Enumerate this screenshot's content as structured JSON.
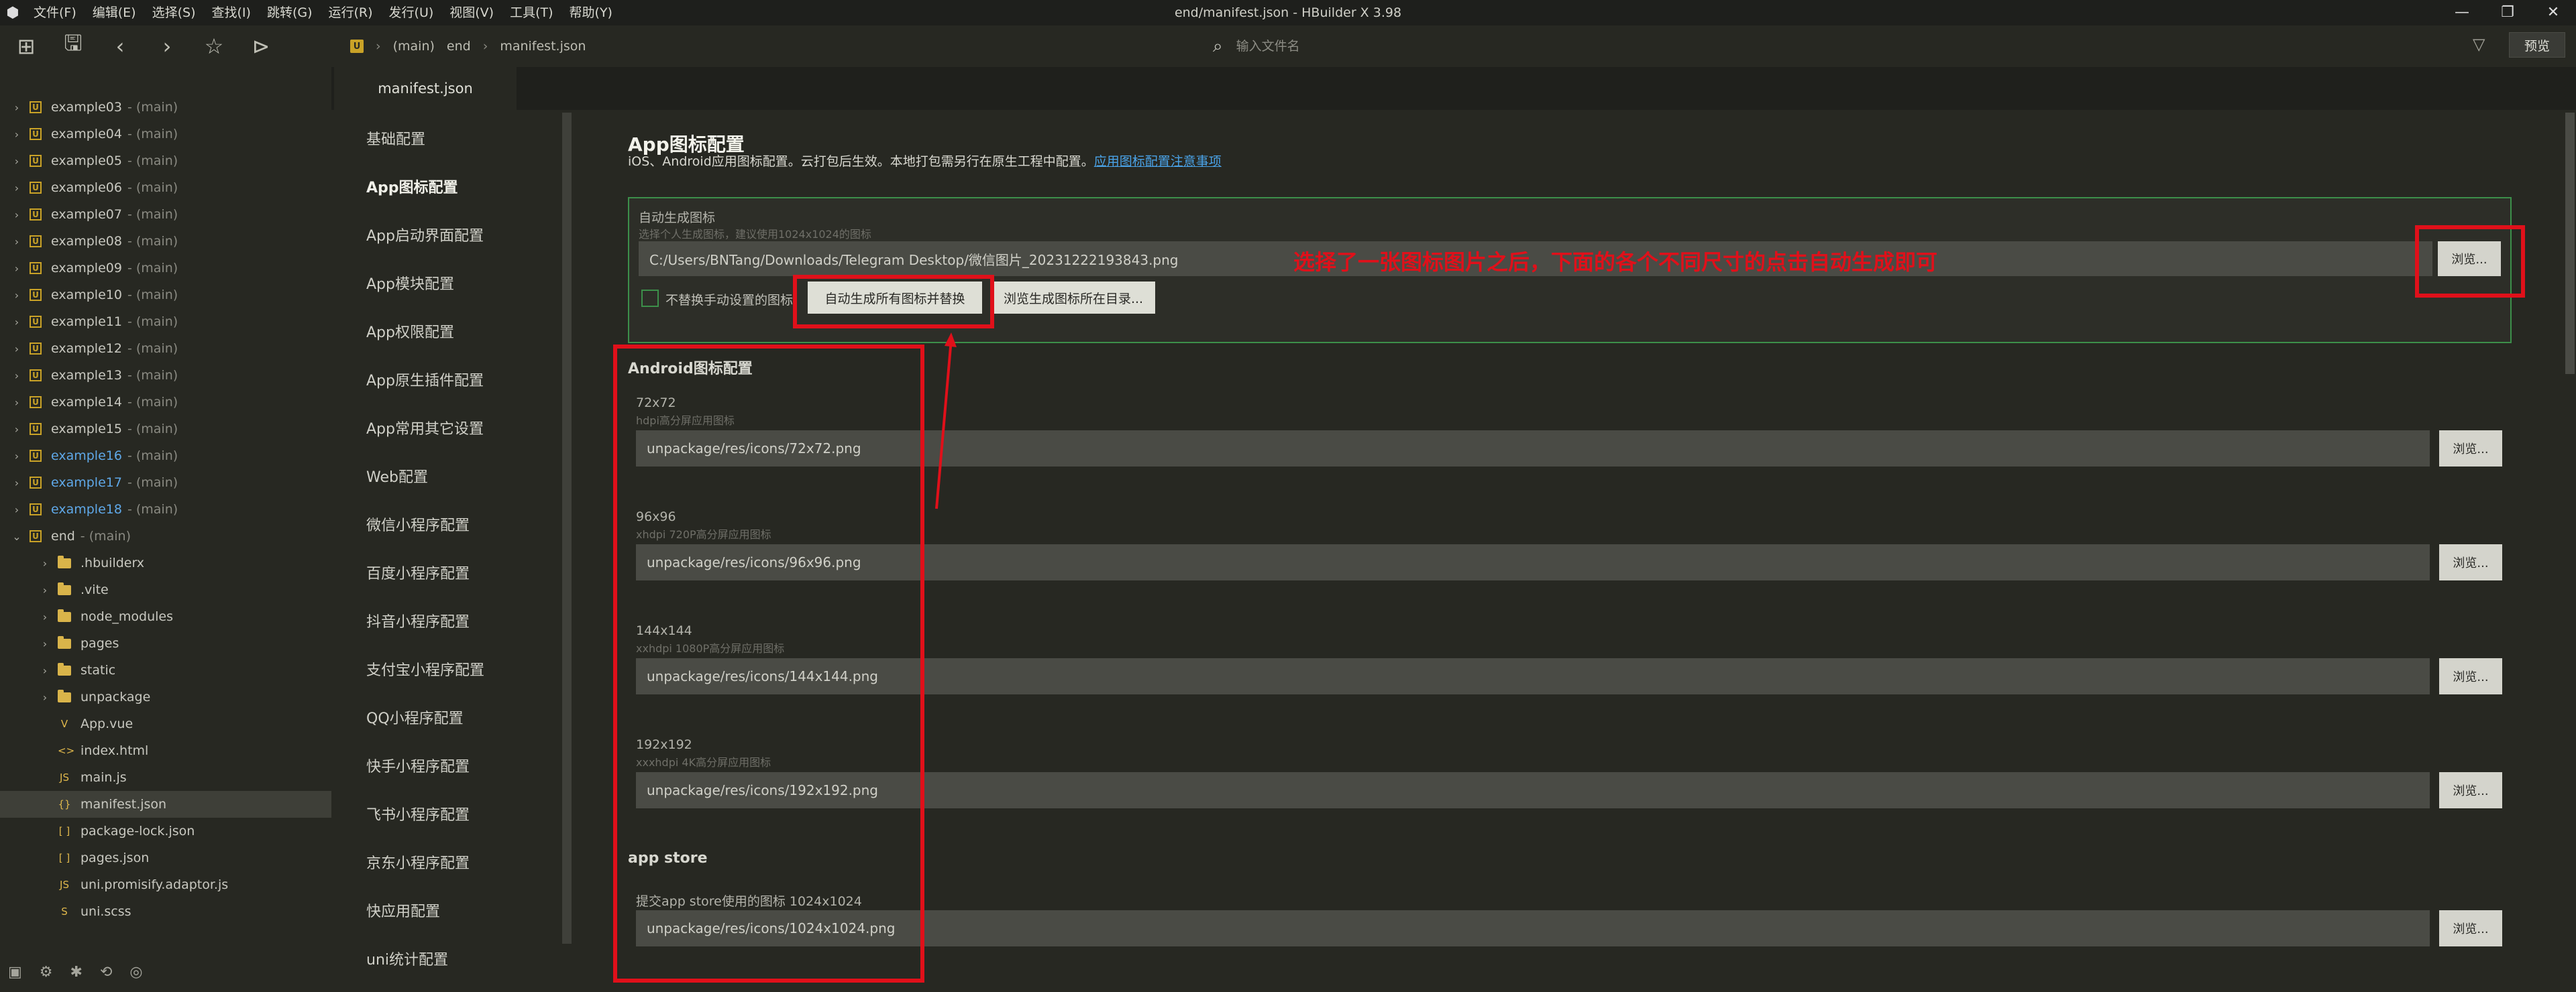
{
  "window": {
    "title": "end/manifest.json - HBuilder X 3.98",
    "controls": [
      "—",
      "❐",
      "✕"
    ]
  },
  "menu": [
    "文件(F)",
    "编辑(E)",
    "选择(S)",
    "查找(I)",
    "跳转(G)",
    "运行(R)",
    "发行(U)",
    "视图(V)",
    "工具(T)",
    "帮助(Y)"
  ],
  "toolbar": {
    "breadcrumb": {
      "badge": "U",
      "items": [
        "(main)",
        "end",
        "manifest.json"
      ]
    },
    "search_placeholder": "输入文件名",
    "preview_label": "预览"
  },
  "tree": {
    "projects": [
      {
        "name": "example03",
        "branch": "- (main)",
        "blue": false
      },
      {
        "name": "example04",
        "branch": "- (main)",
        "blue": false
      },
      {
        "name": "example05",
        "branch": "- (main)",
        "blue": false
      },
      {
        "name": "example06",
        "branch": "- (main)",
        "blue": false
      },
      {
        "name": "example07",
        "branch": "- (main)",
        "blue": false
      },
      {
        "name": "example08",
        "branch": "- (main)",
        "blue": false
      },
      {
        "name": "example09",
        "branch": "- (main)",
        "blue": false
      },
      {
        "name": "example10",
        "branch": "- (main)",
        "blue": false
      },
      {
        "name": "example11",
        "branch": "- (main)",
        "blue": false
      },
      {
        "name": "example12",
        "branch": "- (main)",
        "blue": false
      },
      {
        "name": "example13",
        "branch": "- (main)",
        "blue": false
      },
      {
        "name": "example14",
        "branch": "- (main)",
        "blue": false
      },
      {
        "name": "example15",
        "branch": "- (main)",
        "blue": false
      },
      {
        "name": "example16",
        "branch": "- (main)",
        "blue": true
      },
      {
        "name": "example17",
        "branch": "- (main)",
        "blue": true
      },
      {
        "name": "example18",
        "branch": "- (main)",
        "blue": true
      }
    ],
    "open_project": {
      "name": "end",
      "branch": "- (main)"
    },
    "folders": [
      ".hbuilderx",
      ".vite",
      "node_modules",
      "pages",
      "static",
      "unpackage"
    ],
    "files": [
      {
        "name": "App.vue",
        "icon": "V"
      },
      {
        "name": "index.html",
        "icon": "<>"
      },
      {
        "name": "main.js",
        "icon": "JS"
      },
      {
        "name": "manifest.json",
        "icon": "{}",
        "selected": true
      },
      {
        "name": "package-lock.json",
        "icon": "[ ]"
      },
      {
        "name": "pages.json",
        "icon": "[ ]"
      },
      {
        "name": "uni.promisify.adaptor.js",
        "icon": "JS"
      },
      {
        "name": "uni.scss",
        "icon": "S"
      }
    ]
  },
  "editor": {
    "tab_label": "manifest.json",
    "nav": [
      {
        "label": "基础配置",
        "active": false
      },
      {
        "label": "App图标配置",
        "active": true
      },
      {
        "label": "App启动界面配置",
        "active": false
      },
      {
        "label": "App模块配置",
        "active": false
      },
      {
        "label": "App权限配置",
        "active": false
      },
      {
        "label": "App原生插件配置",
        "active": false
      },
      {
        "label": "App常用其它设置",
        "active": false
      },
      {
        "label": "Web配置",
        "active": false
      },
      {
        "label": "微信小程序配置",
        "active": false
      },
      {
        "label": "百度小程序配置",
        "active": false
      },
      {
        "label": "抖音小程序配置",
        "active": false
      },
      {
        "label": "支付宝小程序配置",
        "active": false
      },
      {
        "label": "QQ小程序配置",
        "active": false
      },
      {
        "label": "快手小程序配置",
        "active": false
      },
      {
        "label": "飞书小程序配置",
        "active": false
      },
      {
        "label": "京东小程序配置",
        "active": false
      },
      {
        "label": "快应用配置",
        "active": false
      },
      {
        "label": "uni统计配置",
        "active": false
      }
    ],
    "page_title": "App图标配置",
    "page_desc": "iOS、Android应用图标配置。云打包后生效。本地打包需另行在原生工程中配置。",
    "page_link": "应用图标配置注意事项",
    "auto": {
      "label": "自动生成图标",
      "hint": "选择个人生成图标，建议使用1024x1024的图标",
      "path": "C:/Users/BNTang/Downloads/Telegram Desktop/微信图片_20231222193843.png",
      "browse": "浏览...",
      "checkbox_label": "不替换手动设置的图标",
      "generate_button": "自动生成所有图标并替换",
      "open_dir_button": "浏览生成图标所在目录..."
    },
    "android_title": "Android图标配置",
    "android_icons": [
      {
        "size": "72x72",
        "hint": "hdpi高分屏应用图标",
        "path": "unpackage/res/icons/72x72.png"
      },
      {
        "size": "96x96",
        "hint": "xhdpi 720P高分屏应用图标",
        "path": "unpackage/res/icons/96x96.png"
      },
      {
        "size": "144x144",
        "hint": "xxhdpi 1080P高分屏应用图标",
        "path": "unpackage/res/icons/144x144.png"
      },
      {
        "size": "192x192",
        "hint": "xxxhdpi 4K高分屏应用图标",
        "path": "unpackage/res/icons/192x192.png"
      }
    ],
    "appstore_title": "app store",
    "appstore": {
      "label": "提交app store使用的图标 1024x1024",
      "path": "unpackage/res/icons/1024x1024.png"
    },
    "browse_label": "浏览..."
  },
  "annotation": {
    "text": "选择了一张图标图片之后，下面的各个不同尺寸的点击自动生成即可",
    "color": "#e0101a"
  }
}
